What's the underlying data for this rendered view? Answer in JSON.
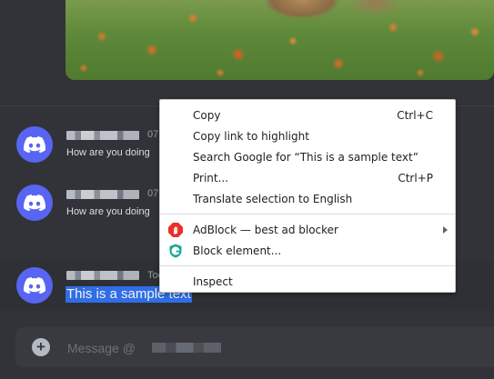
{
  "messages": [
    {
      "timestamp": "07",
      "text": "How are you doing"
    },
    {
      "timestamp": "07",
      "text": "How are you doing"
    },
    {
      "timestamp": "Toc",
      "text": "This is a sample text"
    }
  ],
  "composer": {
    "placeholder": "Message @"
  },
  "context_menu": {
    "items": [
      {
        "label": "Copy",
        "shortcut": "Ctrl+C"
      },
      {
        "label": "Copy link to highlight",
        "shortcut": ""
      },
      {
        "label": "Search Google for “This is a sample text”",
        "shortcut": ""
      },
      {
        "label": "Print...",
        "shortcut": "Ctrl+P"
      },
      {
        "label": "Translate selection to English",
        "shortcut": ""
      },
      {
        "label": "AdBlock — best ad blocker",
        "shortcut": "",
        "icon": "adblock-hand-icon"
      },
      {
        "label": "Block element...",
        "shortcut": "",
        "icon": "adblock-shield-icon"
      },
      {
        "label": "Inspect",
        "shortcut": ""
      }
    ]
  },
  "colors": {
    "background": "#313338",
    "avatar": "#5865f2",
    "selection": "#2f6ee6",
    "adblock_red": "#e8302a",
    "adblock_teal": "#1aa596"
  }
}
